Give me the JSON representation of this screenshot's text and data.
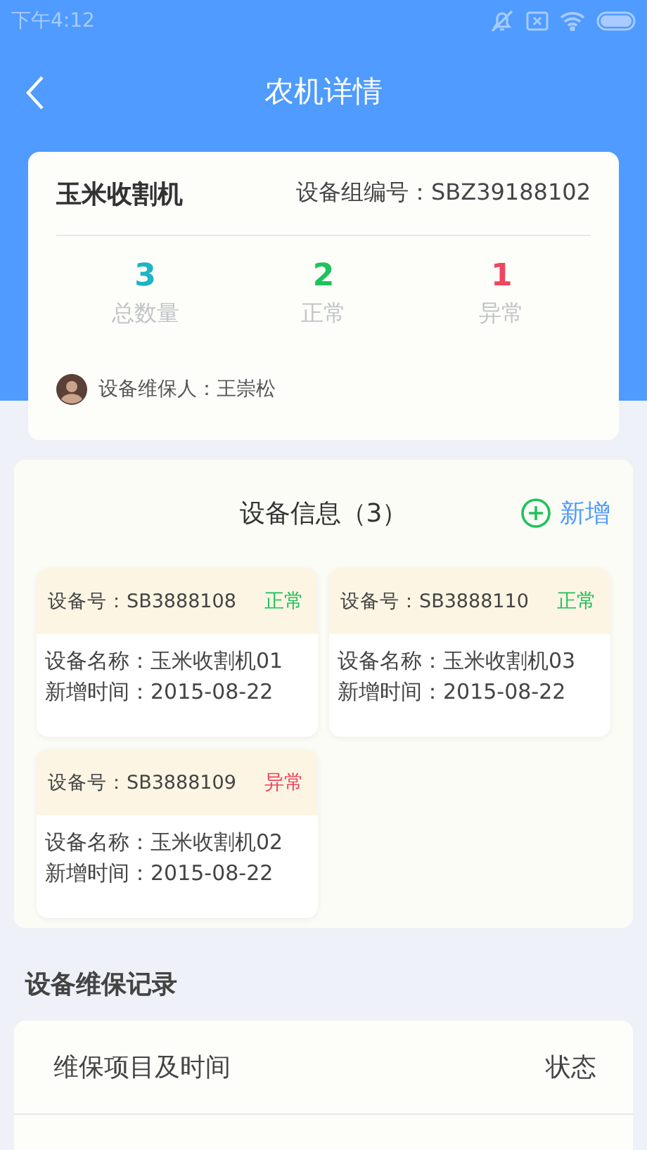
{
  "status_bar": {
    "time": "下午4:12"
  },
  "header": {
    "title": "农机详情"
  },
  "summary": {
    "name": "玉米收割机",
    "group_code": "设备组编号：SBZ39188102",
    "stats": [
      {
        "value": "3",
        "label": "总数量",
        "kind": "total"
      },
      {
        "value": "2",
        "label": "正常",
        "kind": "normal"
      },
      {
        "value": "1",
        "label": "异常",
        "kind": "abnormal"
      }
    ],
    "maintainer": "设备维保人：王崇松"
  },
  "devices": {
    "title": "设备信息（3）",
    "add_label": "新增",
    "items": [
      {
        "code": "设备号：SB3888108",
        "status": "正常",
        "kind": "normal",
        "name": "设备名称：玉米收割机01",
        "date": "新增时间：2015-08-22"
      },
      {
        "code": "设备号：SB3888110",
        "status": "正常",
        "kind": "normal",
        "name": "设备名称：玉米收割机03",
        "date": "新增时间：2015-08-22"
      },
      {
        "code": "设备号：SB3888109",
        "status": "异常",
        "kind": "abnormal",
        "name": "设备名称：玉米收割机02",
        "date": "新增时间：2015-08-22"
      }
    ]
  },
  "records": {
    "title": "设备维保记录",
    "columns": [
      "维保项目及时间",
      "状态"
    ]
  }
}
